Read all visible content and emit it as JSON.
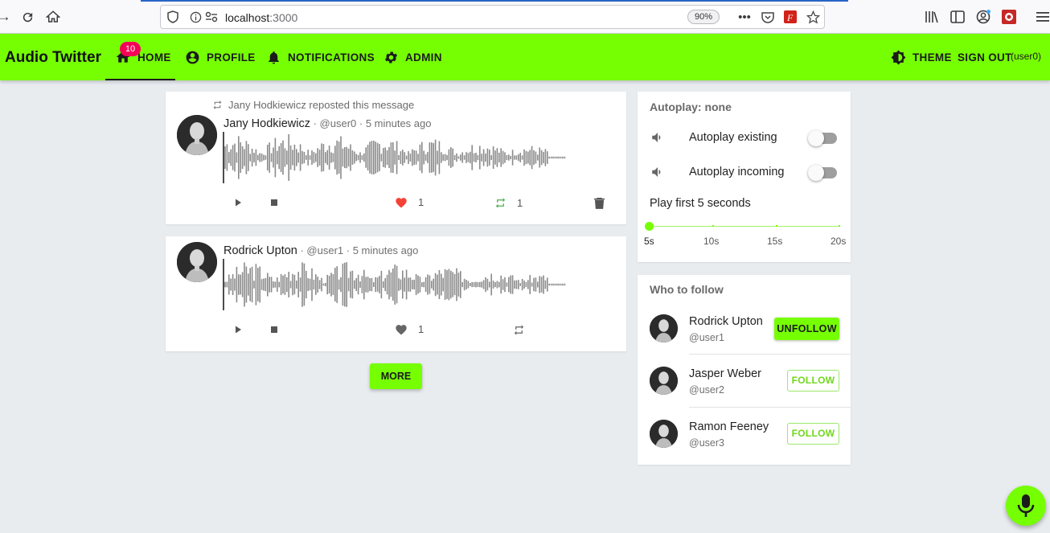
{
  "browser": {
    "url_host": "localhost",
    "url_port": ":3000",
    "zoom": "90%"
  },
  "app": {
    "brand": "Audio Twitter",
    "nav": {
      "home": "HOME",
      "home_badge": "10",
      "profile": "PROFILE",
      "notifications": "NOTIFICATIONS",
      "admin": "ADMIN",
      "theme": "THEME",
      "sign_out": "SIGN OUT",
      "current_user": "(user0)"
    }
  },
  "feed": {
    "posts": [
      {
        "repost_note": "Jany Hodkiewicz reposted this message",
        "author": "Jany Hodkiewicz",
        "meta": " · @user0 · 5 minutes ago",
        "likes": "1",
        "reposts": "1",
        "liked": true,
        "reposted": true
      },
      {
        "author": "Rodrick Upton",
        "meta": " · @user1 · 5 minutes ago",
        "likes": "1",
        "liked": false,
        "reposted": false
      }
    ],
    "more_label": "MORE"
  },
  "autoplay": {
    "title": "Autoplay: none",
    "existing_label": "Autoplay existing",
    "incoming_label": "Autoplay incoming",
    "play_first_label": "Play first 5 seconds",
    "slider_ticks": [
      "5s",
      "10s",
      "15s",
      "20s"
    ],
    "slider_value_seconds": 5
  },
  "who_to_follow": {
    "title": "Who to follow",
    "users": [
      {
        "name": "Rodrick Upton",
        "handle": "@user1",
        "button": "UNFOLLOW"
      },
      {
        "name": "Jasper Weber",
        "handle": "@user2",
        "button": "FOLLOW"
      },
      {
        "name": "Ramon Feeney",
        "handle": "@user3",
        "button": "FOLLOW"
      }
    ]
  },
  "colors": {
    "accent": "#76ff03",
    "like_red": "#f44336",
    "repost_green": "#4caf50",
    "badge_pink": "#f50057"
  }
}
